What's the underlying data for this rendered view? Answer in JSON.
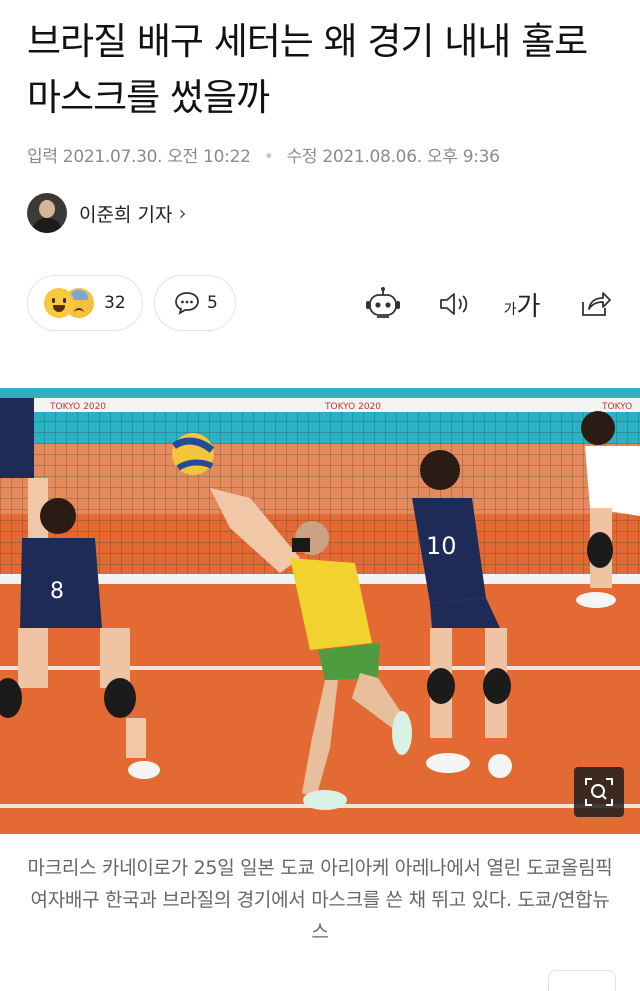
{
  "article": {
    "title": "브라질 배구 세터는 왜 경기 내내 홀로 마스크를 썼을까",
    "dates": {
      "published_label": "입력",
      "published": "2021.07.30. 오전 10:22",
      "updated_label": "수정",
      "updated": "2021.08.06. 오후 9:36"
    },
    "reporter": {
      "name": "이준희 기자",
      "chevron": "›"
    }
  },
  "reactions": {
    "count": "32",
    "icons": [
      "grinning-face-icon",
      "sad-sweat-face-icon"
    ]
  },
  "comments": {
    "count": "5",
    "icon": "speech-bubble-icon"
  },
  "toolbar": {
    "font_size_label_small": "가",
    "font_size_label_large": "가",
    "icons": [
      "robot-summary-icon",
      "speaker-icon",
      "font-size-icon",
      "share-icon"
    ]
  },
  "photo": {
    "banner_text": [
      "TOKYO 2020",
      "TOKYO 2020",
      "TOKYO"
    ],
    "jersey_numbers": [
      "8",
      "10"
    ],
    "zoom_icon": "zoom-search-icon"
  },
  "caption": "마크리스 카네이로가 25일 일본 도쿄 아리아케 아레나에서 열린 도쿄올림픽 여자배구 한국과 브라질의 경기에서 마스크를 쓴 채 뛰고 있다. 도쿄/연합뉴스",
  "colors": {
    "court": "#e9743f",
    "net_band": "#2bb0c4",
    "korea_jersey": "#1e2b57",
    "brazil_jersey": "#f2d22e"
  }
}
